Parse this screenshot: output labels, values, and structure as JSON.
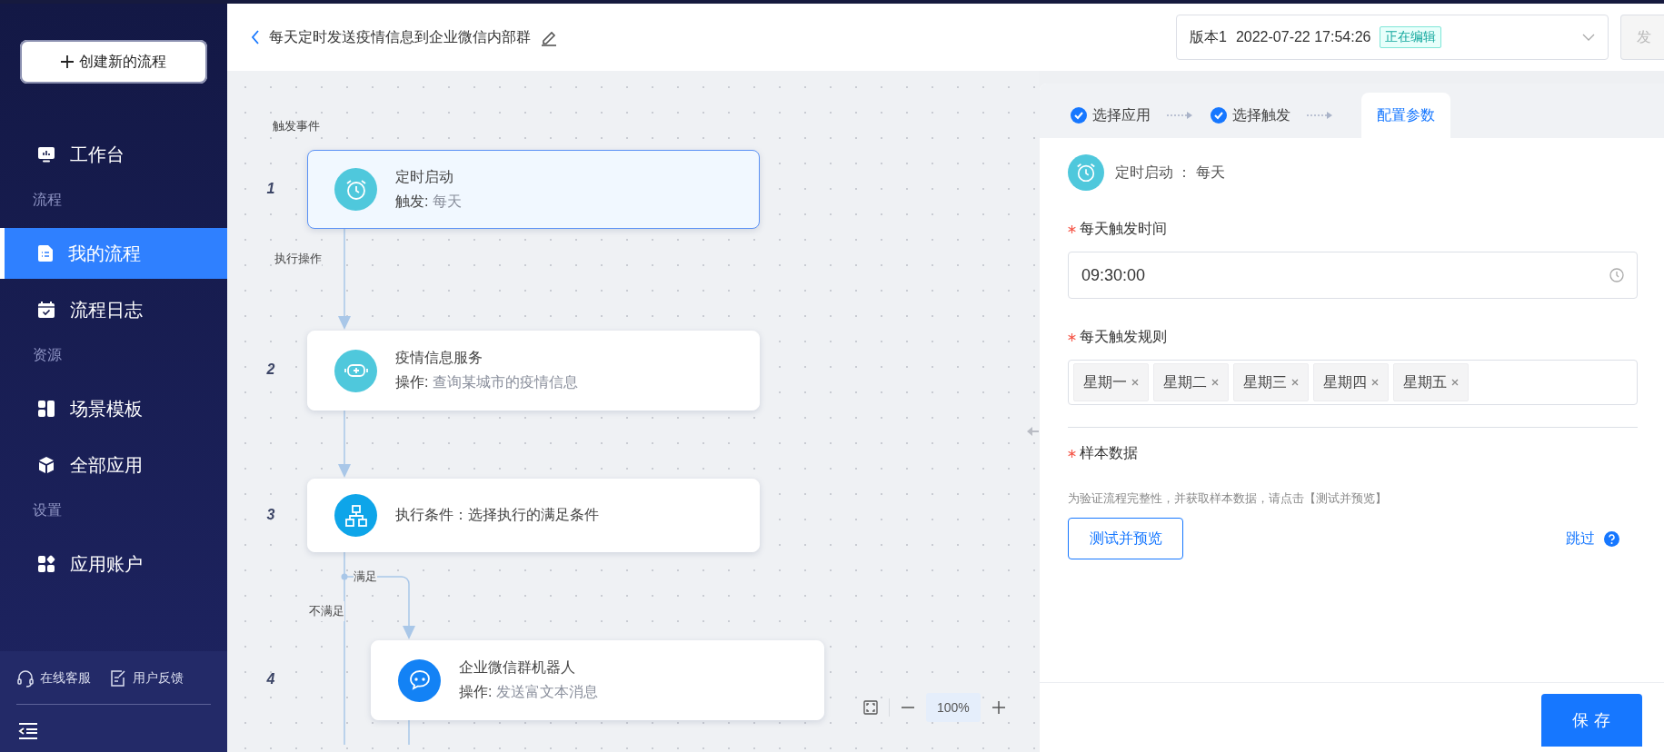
{
  "sidebar": {
    "create_button": "创建新的流程",
    "items": [
      {
        "kind": "nav",
        "label": "工作台",
        "selected": false
      },
      {
        "kind": "group",
        "label": "流程"
      },
      {
        "kind": "nav",
        "label": "我的流程",
        "selected": true
      },
      {
        "kind": "nav",
        "label": "流程日志",
        "selected": false
      },
      {
        "kind": "group",
        "label": "资源"
      },
      {
        "kind": "nav",
        "label": "场景模板",
        "selected": false
      },
      {
        "kind": "nav",
        "label": "全部应用",
        "selected": false
      },
      {
        "kind": "group",
        "label": "设置"
      },
      {
        "kind": "nav",
        "label": "应用账户",
        "selected": false
      }
    ],
    "footer_links": [
      "在线客服",
      "用户反馈"
    ]
  },
  "header": {
    "title": "每天定时发送疫情信息到企业微信内部群",
    "version": {
      "label": "版本1",
      "time": "2022-07-22 17:54:26",
      "status": "正在编辑"
    },
    "publish_button": "发"
  },
  "flow": {
    "trigger_label": "触发事件",
    "nodes": [
      {
        "number": "1",
        "kind": "step",
        "color": "#4fc8dc",
        "title": "定时启动",
        "detail_label": "触发:",
        "detail": "每天",
        "selected": true
      },
      {
        "number": "2",
        "kind": "step",
        "color": "#4fc8dc",
        "title": "疫情信息服务",
        "detail_label": "操作:",
        "detail": "查询某城市的疫情信息",
        "selected": false
      },
      {
        "number": "3",
        "kind": "condition",
        "color": "#0ea5e9",
        "title": "执行条件：选择执行的满足条件",
        "selected": false
      },
      {
        "number": "4",
        "kind": "step",
        "color": "#1382f5",
        "title": "企业微信群机器人",
        "detail_label": "操作:",
        "detail": "发送富文本消息",
        "selected": false
      }
    ],
    "edge_labels": {
      "action": "执行操作",
      "yes": "满足",
      "no": "不满足"
    },
    "zoom": "100%"
  },
  "panel": {
    "steps": [
      {
        "label": "选择应用",
        "done": true,
        "selected": false
      },
      {
        "label": "选择触发",
        "done": true,
        "selected": false
      },
      {
        "label": "配置参数",
        "done": false,
        "selected": true
      }
    ],
    "summary": "定时启动 ： 每天",
    "time_field": {
      "label": "每天触发时间",
      "required": true,
      "value": "09:30:00"
    },
    "rule_field": {
      "label": "每天触发规则",
      "required": true,
      "tags": [
        "星期一",
        "星期二",
        "星期三",
        "星期四",
        "星期五"
      ]
    },
    "sample": {
      "label": "样本数据",
      "required": true,
      "hint": "为验证流程完整性，并获取样本数据，请点击【测试并预览】",
      "test_button": "测试并预览",
      "skip_link": "跳过"
    },
    "save_button": "保存"
  }
}
